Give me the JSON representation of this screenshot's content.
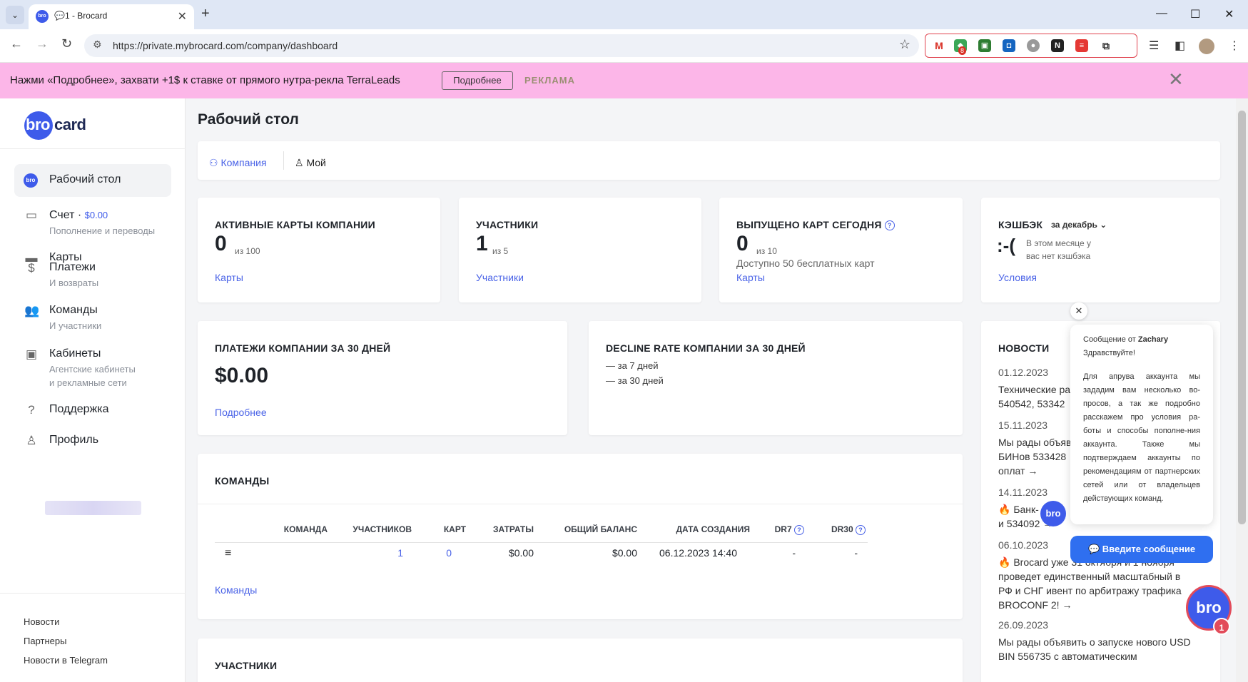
{
  "browser": {
    "tab_title": "💬1 - Brocard",
    "favicon_text": "bro",
    "url": "https://private.mybrocard.com/company/dashboard",
    "extension_badge": "8"
  },
  "promo": {
    "text": "Нажми «Подробнее», захвати +1$ к ставке от прямого нутра-рекла TerraLeads",
    "button": "Подробнее",
    "ad_label": "РЕКЛАМА"
  },
  "logo": {
    "bro": "bro",
    "card": "card"
  },
  "sidebar": {
    "items": [
      {
        "label": "Рабочий стол",
        "sub": ""
      },
      {
        "label": "Счет",
        "amount": "$0.00",
        "sub": "Пополнение и переводы"
      },
      {
        "label": "Карты",
        "sub": ""
      },
      {
        "label": "Платежи",
        "sub": "И возвраты"
      },
      {
        "label": "Команды",
        "sub": "И участники"
      },
      {
        "label": "Кабинеты",
        "sub": "Агентские кабинеты",
        "sub2": "и рекламные сети"
      },
      {
        "label": "Поддержка",
        "sub": ""
      },
      {
        "label": "Профиль",
        "sub": ""
      }
    ],
    "footer_links": [
      "Новости",
      "Партнеры",
      "Новости в Telegram"
    ]
  },
  "main": {
    "title": "Рабочий стол",
    "tabs": [
      "Компания",
      "Мой"
    ],
    "active_cards": {
      "title": "АКТИВНЫЕ КАРТЫ КОМПАНИИ",
      "value": "0",
      "of": "из  100",
      "link": "Карты"
    },
    "members": {
      "title": "УЧАСТНИКИ",
      "value": "1",
      "of": "из  5",
      "link": "Участники"
    },
    "issued": {
      "title": "ВЫПУЩЕНО КАРТ СЕГОДНЯ",
      "value": "0",
      "of": "из  10",
      "note": "Доступно 50 бесплатных карт",
      "link": "Карты"
    },
    "cashback": {
      "title": "КЭШБЭК",
      "period": "за декабрь",
      "face": ":-(",
      "msg1": "В этом месяце у",
      "msg2": "вас нет кэшбэка",
      "link": "Условия"
    },
    "payments": {
      "title": "ПЛАТЕЖИ КОМПАНИИ ЗА 30 ДНЕЙ",
      "value": "$0.00",
      "link": "Подробнее"
    },
    "decline": {
      "title": "DECLINE RATE КОМПАНИИ ЗА 30 ДНЕЙ",
      "line1": "— за 7 дней",
      "line2": "— за 30 дней"
    },
    "teams": {
      "title": "КОМАНДЫ",
      "headers": [
        "КОМАНДА",
        "УЧАСТНИКОВ",
        "КАРТ",
        "ЗАТРАТЫ",
        "ОБЩИЙ БАЛАНС",
        "ДАТА СОЗДАНИЯ",
        "DR7",
        "DR30"
      ],
      "row": {
        "menu": "≡",
        "members": "1",
        "cards": "0",
        "spend": "$0.00",
        "balance": "$0.00",
        "created": "06.12.2023 14:40",
        "dr7": "-",
        "dr30": "-"
      },
      "link": "Команды"
    },
    "participants_title": "УЧАСТНИКИ"
  },
  "news": {
    "title": "НОВОСТИ",
    "items": [
      {
        "date": "01.12.2023",
        "l1": "Технические ра",
        "l2": "540542, 53342"
      },
      {
        "date": "15.11.2023",
        "l1": "Мы рады объяв",
        "l2": "БИНов 533428",
        "l3": "оплат →"
      },
      {
        "date": "14.11.2023",
        "l1": "🔥 Банк-",
        "l2": "и 534092 →"
      },
      {
        "date": "06.10.2023",
        "l1": "🔥 Brocard уже 31 октября и 1 ноября",
        "l2": "проведет единственный масштабный в",
        "l3": "РФ и СНГ ивент по арбитражу трафика",
        "l4": "BROCONF 2! →"
      },
      {
        "date": "26.09.2023",
        "l1": "Мы рады объявить о запуске нового USD",
        "l2": "BIN 556735 с автоматическим"
      }
    ]
  },
  "chat": {
    "from_prefix": "Сообщение от ",
    "from_name": "Zachary",
    "greeting": "Здравствуйте!",
    "body": "Для апрува аккаунта мы зададим вам несколько во-просов, а так же подробно расскажем про условия ра-боты и способы пополне-ния аккаунта. Также мы подтверждаем аккаунты по рекомендациям от партнерских сетей или от владельцев действующих команд.",
    "input_label": "Введите сообщение",
    "avatar_text": "bro",
    "fab_text": "bro",
    "fab_badge": "1"
  },
  "colors": {
    "accent": "#4a63e7",
    "brand": "#3e5bea",
    "promo_bg": "#fcb6e8"
  }
}
